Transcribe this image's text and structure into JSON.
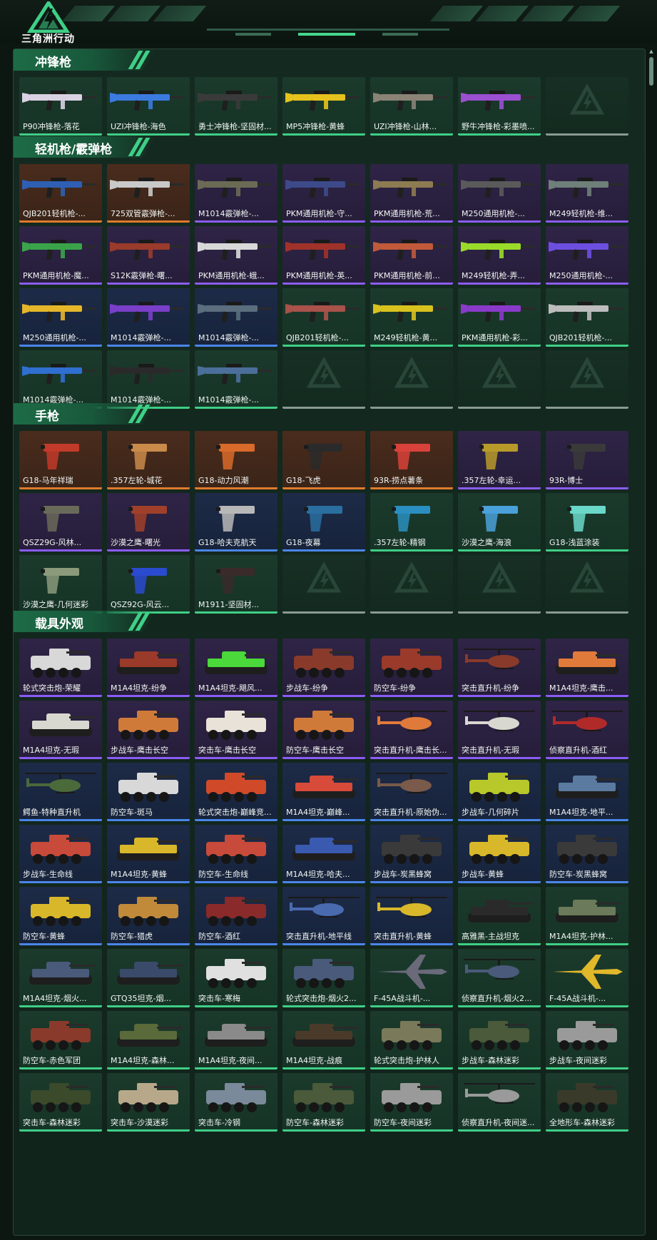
{
  "app": {
    "logo_text": "三角洲行动"
  },
  "sections": [
    {
      "id": "smg",
      "title": "冲锋枪",
      "items": [
        {
          "label": "P90冲锋枪-落花",
          "rarity": "green",
          "kind": "gun",
          "tint": "#d9d2e2"
        },
        {
          "label": "UZI冲锋枪-海色",
          "rarity": "green",
          "kind": "gun",
          "tint": "#3b7be0"
        },
        {
          "label": "勇士冲锋枪-坚固材...",
          "rarity": "green",
          "kind": "gun",
          "tint": "#3a3a3a"
        },
        {
          "label": "MP5冲锋枪-黄蜂",
          "rarity": "green",
          "kind": "gun",
          "tint": "#e5c21d"
        },
        {
          "label": "UZI冲锋枪-山林...",
          "rarity": "green",
          "kind": "gun",
          "tint": "#8a8376"
        },
        {
          "label": "野牛冲锋枪-彩墨喷...",
          "rarity": "green",
          "kind": "gun",
          "tint": "#9b4fd1"
        },
        {
          "label": "",
          "rarity": "empty",
          "kind": "empty",
          "tint": ""
        }
      ]
    },
    {
      "id": "lmg-shotgun",
      "title": "轻机枪/霰弹枪",
      "items": [
        {
          "label": "QJB201轻机枪-...",
          "rarity": "orange",
          "kind": "gun",
          "tint": "#2e5fb3"
        },
        {
          "label": "725双管霰弹枪-...",
          "rarity": "orange",
          "kind": "gun",
          "tint": "#c9c9c9"
        },
        {
          "label": "M1014霰弹枪-...",
          "rarity": "purple",
          "kind": "gun",
          "tint": "#6b6b55"
        },
        {
          "label": "PKM通用机枪-守...",
          "rarity": "purple",
          "kind": "gun",
          "tint": "#3d4a8a"
        },
        {
          "label": "PKM通用机枪-荒...",
          "rarity": "purple",
          "kind": "gun",
          "tint": "#8d7b52"
        },
        {
          "label": "M250通用机枪-...",
          "rarity": "purple",
          "kind": "gun",
          "tint": "#5a5a5a"
        },
        {
          "label": "M249轻机枪-维...",
          "rarity": "purple",
          "kind": "gun",
          "tint": "#6f7f7a"
        },
        {
          "label": "PKM通用机枪-魔...",
          "rarity": "purple",
          "kind": "gun",
          "tint": "#3aa34a"
        },
        {
          "label": "S12K霰弹枪-曙...",
          "rarity": "purple",
          "kind": "gun",
          "tint": "#9a3b2c"
        },
        {
          "label": "PKM通用机枪-蛾...",
          "rarity": "purple",
          "kind": "gun",
          "tint": "#d8d8d8"
        },
        {
          "label": "PKM通用机枪-英...",
          "rarity": "purple",
          "kind": "gun",
          "tint": "#a0322a"
        },
        {
          "label": "PKM通用机枪-前...",
          "rarity": "purple",
          "kind": "gun",
          "tint": "#c05a3a"
        },
        {
          "label": "M249轻机枪-弄...",
          "rarity": "purple",
          "kind": "gun",
          "tint": "#9adb2a"
        },
        {
          "label": "M250通用机枪-...",
          "rarity": "purple",
          "kind": "gun",
          "tint": "#6d4fe0"
        },
        {
          "label": "M250通用机枪-...",
          "rarity": "blue",
          "kind": "gun",
          "tint": "#e5b62a"
        },
        {
          "label": "M1014霰弹枪-...",
          "rarity": "blue",
          "kind": "gun",
          "tint": "#7a3fc9"
        },
        {
          "label": "M1014霰弹枪-...",
          "rarity": "blue",
          "kind": "gun",
          "tint": "#5a6e7e"
        },
        {
          "label": "QJB201轻机枪-...",
          "rarity": "green",
          "kind": "gun",
          "tint": "#a8524a"
        },
        {
          "label": "M249轻机枪-黄...",
          "rarity": "green",
          "kind": "gun",
          "tint": "#d8c21e"
        },
        {
          "label": "PKM通用机枪-彩...",
          "rarity": "green",
          "kind": "gun",
          "tint": "#8a3ac9"
        },
        {
          "label": "QJB201轻机枪-...",
          "rarity": "green",
          "kind": "gun",
          "tint": "#bdbdbd"
        },
        {
          "label": "M1014霰弹枪-...",
          "rarity": "green",
          "kind": "gun",
          "tint": "#2f6fd0"
        },
        {
          "label": "M1014霰弹枪-...",
          "rarity": "green",
          "kind": "gun",
          "tint": "#2a2a2a"
        },
        {
          "label": "M1014霰弹枪-...",
          "rarity": "green",
          "kind": "gun",
          "tint": "#4b6f9a"
        },
        {
          "label": "",
          "rarity": "empty",
          "kind": "empty",
          "tint": ""
        },
        {
          "label": "",
          "rarity": "empty",
          "kind": "empty",
          "tint": ""
        },
        {
          "label": "",
          "rarity": "empty",
          "kind": "empty",
          "tint": ""
        },
        {
          "label": "",
          "rarity": "empty",
          "kind": "empty",
          "tint": ""
        }
      ]
    },
    {
      "id": "pistol",
      "title": "手枪",
      "items": [
        {
          "label": "G18-马年祥瑞",
          "rarity": "orange",
          "kind": "pistol",
          "tint": "#c23a2a"
        },
        {
          "label": ".357左轮-城花",
          "rarity": "orange",
          "kind": "pistol",
          "tint": "#c98a4a"
        },
        {
          "label": "G18-动力风潮",
          "rarity": "orange",
          "kind": "pistol",
          "tint": "#d86a2a"
        },
        {
          "label": "G18-飞虎",
          "rarity": "orange",
          "kind": "pistol",
          "tint": "#2a2a2a"
        },
        {
          "label": "93R-捞点薯条",
          "rarity": "orange",
          "kind": "pistol",
          "tint": "#d8423a"
        },
        {
          "label": ".357左轮-幸运...",
          "rarity": "purple",
          "kind": "pistol",
          "tint": "#b89a2a"
        },
        {
          "label": "93R-博士",
          "rarity": "purple",
          "kind": "pistol",
          "tint": "#3a3a3a"
        },
        {
          "label": "QSZ29G-风林...",
          "rarity": "purple",
          "kind": "pistol",
          "tint": "#6a6a5a"
        },
        {
          "label": "沙漠之鹰-曙光",
          "rarity": "purple",
          "kind": "pistol",
          "tint": "#a0402a"
        },
        {
          "label": "G18-哈夫克航天",
          "rarity": "blue",
          "kind": "pistol",
          "tint": "#b8b8b8"
        },
        {
          "label": "G18-夜幕",
          "rarity": "blue",
          "kind": "pistol",
          "tint": "#2a6fa0"
        },
        {
          "label": ".357左轮-精钢",
          "rarity": "green",
          "kind": "pistol",
          "tint": "#2a8fc0"
        },
        {
          "label": "沙漠之鹰-海浪",
          "rarity": "green",
          "kind": "pistol",
          "tint": "#4aa0d8"
        },
        {
          "label": "G18-浅蓝涂装",
          "rarity": "green",
          "kind": "pistol",
          "tint": "#6ad8c8"
        },
        {
          "label": "沙漠之鹰-几何迷彩",
          "rarity": "green",
          "kind": "pistol",
          "tint": "#8a9a7a"
        },
        {
          "label": "QSZ92G-风云...",
          "rarity": "green",
          "kind": "pistol",
          "tint": "#2a4ad0"
        },
        {
          "label": "M1911-坚固材...",
          "rarity": "green",
          "kind": "pistol",
          "tint": "#3a2a2a"
        },
        {
          "label": "",
          "rarity": "empty",
          "kind": "empty",
          "tint": ""
        },
        {
          "label": "",
          "rarity": "empty",
          "kind": "empty",
          "tint": ""
        },
        {
          "label": "",
          "rarity": "empty",
          "kind": "empty",
          "tint": ""
        },
        {
          "label": "",
          "rarity": "empty",
          "kind": "empty",
          "tint": ""
        }
      ]
    },
    {
      "id": "vehicle",
      "title": "载具外观",
      "items": [
        {
          "label": "轮式突击炮-荣耀",
          "rarity": "purple",
          "kind": "vehicle",
          "tint": "#d8d8d8"
        },
        {
          "label": "M1A4坦克-纷争",
          "rarity": "purple",
          "kind": "tank",
          "tint": "#9a3a2a"
        },
        {
          "label": "M1A4坦克-飓风...",
          "rarity": "purple",
          "kind": "tank",
          "tint": "#4ad83a"
        },
        {
          "label": "步战车-纷争",
          "rarity": "purple",
          "kind": "vehicle",
          "tint": "#8a3a2a"
        },
        {
          "label": "防空车-纷争",
          "rarity": "purple",
          "kind": "vehicle",
          "tint": "#9a3a2a"
        },
        {
          "label": "突击直升机-纷争",
          "rarity": "purple",
          "kind": "heli",
          "tint": "#8a3a2a"
        },
        {
          "label": "M1A4坦克-鹰击...",
          "rarity": "purple",
          "kind": "tank",
          "tint": "#e07a3a"
        },
        {
          "label": "M1A4坦克-无瑕",
          "rarity": "purple",
          "kind": "tank",
          "tint": "#d8d8d0"
        },
        {
          "label": "步战车-鹰击长空",
          "rarity": "purple",
          "kind": "vehicle",
          "tint": "#d07a3a"
        },
        {
          "label": "突击车-鹰击长空",
          "rarity": "purple",
          "kind": "vehicle",
          "tint": "#e8e2d8"
        },
        {
          "label": "防空车-鹰击长空",
          "rarity": "purple",
          "kind": "vehicle",
          "tint": "#d07a3a"
        },
        {
          "label": "突击直升机-鹰击长...",
          "rarity": "purple",
          "kind": "heli",
          "tint": "#e07a3a"
        },
        {
          "label": "突击直升机-无瑕",
          "rarity": "purple",
          "kind": "heli",
          "tint": "#d8d8d0"
        },
        {
          "label": "侦察直升机-酒红",
          "rarity": "purple",
          "kind": "heli",
          "tint": "#b02a2a"
        },
        {
          "label": "鳄鱼-特种直升机",
          "rarity": "blue",
          "kind": "heli",
          "tint": "#4a6a3a"
        },
        {
          "label": "防空车-斑马",
          "rarity": "blue",
          "kind": "vehicle",
          "tint": "#d8d8d8"
        },
        {
          "label": "轮式突击炮-巅峰竞...",
          "rarity": "blue",
          "kind": "vehicle",
          "tint": "#d04a2a"
        },
        {
          "label": "M1A4坦克-巅峰...",
          "rarity": "blue",
          "kind": "tank",
          "tint": "#d84a3a"
        },
        {
          "label": "突击直升机-原始伪...",
          "rarity": "blue",
          "kind": "heli",
          "tint": "#7a5a4a"
        },
        {
          "label": "步战车-几何碎片",
          "rarity": "blue",
          "kind": "vehicle",
          "tint": "#b8c82a"
        },
        {
          "label": "M1A4坦克-地平...",
          "rarity": "blue",
          "kind": "tank",
          "tint": "#5a7aa0"
        },
        {
          "label": "步战车-生命线",
          "rarity": "blue",
          "kind": "vehicle",
          "tint": "#c84a3a"
        },
        {
          "label": "M1A4坦克-黄蜂",
          "rarity": "blue",
          "kind": "tank",
          "tint": "#d8b82a"
        },
        {
          "label": "防空车-生命线",
          "rarity": "blue",
          "kind": "vehicle",
          "tint": "#c84a3a"
        },
        {
          "label": "M1A4坦克-哈夫...",
          "rarity": "blue",
          "kind": "tank",
          "tint": "#3a5ab0"
        },
        {
          "label": "步战车-炭黑蜂窝",
          "rarity": "blue",
          "kind": "vehicle",
          "tint": "#3a3a3a"
        },
        {
          "label": "步战车-黄蜂",
          "rarity": "blue",
          "kind": "vehicle",
          "tint": "#d8b82a"
        },
        {
          "label": "防空车-炭黑蜂窝",
          "rarity": "blue",
          "kind": "vehicle",
          "tint": "#3a3a3a"
        },
        {
          "label": "防空车-黄蜂",
          "rarity": "blue",
          "kind": "vehicle",
          "tint": "#d8b82a"
        },
        {
          "label": "防空车-猎虎",
          "rarity": "blue",
          "kind": "vehicle",
          "tint": "#c08a3a"
        },
        {
          "label": "防空车-酒红",
          "rarity": "blue",
          "kind": "vehicle",
          "tint": "#8a2a2a"
        },
        {
          "label": "突击直升机-地平线",
          "rarity": "blue",
          "kind": "heli",
          "tint": "#4a6ab0"
        },
        {
          "label": "突击直升机-黄蜂",
          "rarity": "blue",
          "kind": "heli",
          "tint": "#d8b82a"
        },
        {
          "label": "高雅黑-主战坦克",
          "rarity": "green",
          "kind": "tank",
          "tint": "#2a2a2a"
        },
        {
          "label": "M1A4坦克-护林...",
          "rarity": "green",
          "kind": "tank",
          "tint": "#6a7a5a"
        },
        {
          "label": "M1A4坦克-烟火...",
          "rarity": "green",
          "kind": "tank",
          "tint": "#4a5a7a"
        },
        {
          "label": "GTQ35坦克-烟...",
          "rarity": "green",
          "kind": "tank",
          "tint": "#3a4a6a"
        },
        {
          "label": "突击车-寒梅",
          "rarity": "green",
          "kind": "vehicle",
          "tint": "#e0e0e0"
        },
        {
          "label": "轮式突击炮-烟火2...",
          "rarity": "green",
          "kind": "vehicle",
          "tint": "#4a5a7a"
        },
        {
          "label": "F-45A战斗机-...",
          "rarity": "green",
          "kind": "jet",
          "tint": "#6a6a7a"
        },
        {
          "label": "侦察直升机-烟火2...",
          "rarity": "green",
          "kind": "heli",
          "tint": "#4a5a7a"
        },
        {
          "label": "F-45A战斗机-...",
          "rarity": "green",
          "kind": "jet",
          "tint": "#e0b82a"
        },
        {
          "label": "防空车-赤色军团",
          "rarity": "green",
          "kind": "vehicle",
          "tint": "#8a3a2a"
        },
        {
          "label": "M1A4坦克-森林...",
          "rarity": "green",
          "kind": "tank",
          "tint": "#5a6a3a"
        },
        {
          "label": "M1A4坦克-夜间...",
          "rarity": "green",
          "kind": "tank",
          "tint": "#8a8a8a"
        },
        {
          "label": "M1A4坦克-战痕",
          "rarity": "green",
          "kind": "tank",
          "tint": "#4a3a2a"
        },
        {
          "label": "轮式突击炮-护林人",
          "rarity": "green",
          "kind": "vehicle",
          "tint": "#7a7a5a"
        },
        {
          "label": "步战车-森林迷彩",
          "rarity": "green",
          "kind": "vehicle",
          "tint": "#4a5a3a"
        },
        {
          "label": "步战车-夜间迷彩",
          "rarity": "green",
          "kind": "vehicle",
          "tint": "#9a9a9a"
        },
        {
          "label": "突击车-森林迷彩",
          "rarity": "green",
          "kind": "vehicle",
          "tint": "#3a4a2a"
        },
        {
          "label": "突击车-沙漠迷彩",
          "rarity": "green",
          "kind": "vehicle",
          "tint": "#b8a88a"
        },
        {
          "label": "突击车-冷钢",
          "rarity": "green",
          "kind": "vehicle",
          "tint": "#7a8a9a"
        },
        {
          "label": "防空车-森林迷彩",
          "rarity": "green",
          "kind": "vehicle",
          "tint": "#4a5a3a"
        },
        {
          "label": "防空车-夜间迷彩",
          "rarity": "green",
          "kind": "vehicle",
          "tint": "#9a9a9a"
        },
        {
          "label": "侦察直升机-夜间迷...",
          "rarity": "green",
          "kind": "heli",
          "tint": "#9a9a9a"
        },
        {
          "label": "全地形车-森林迷彩",
          "rarity": "green",
          "kind": "vehicle",
          "tint": "#3a3a2a"
        }
      ]
    }
  ],
  "colors": {
    "accent": "#3fcf86",
    "rarity_green": "#3fcf86",
    "rarity_purple": "#8b5cf6",
    "rarity_orange": "#e07b2c",
    "rarity_blue": "#4a86e8",
    "empty_bar": "#8a9a92"
  }
}
